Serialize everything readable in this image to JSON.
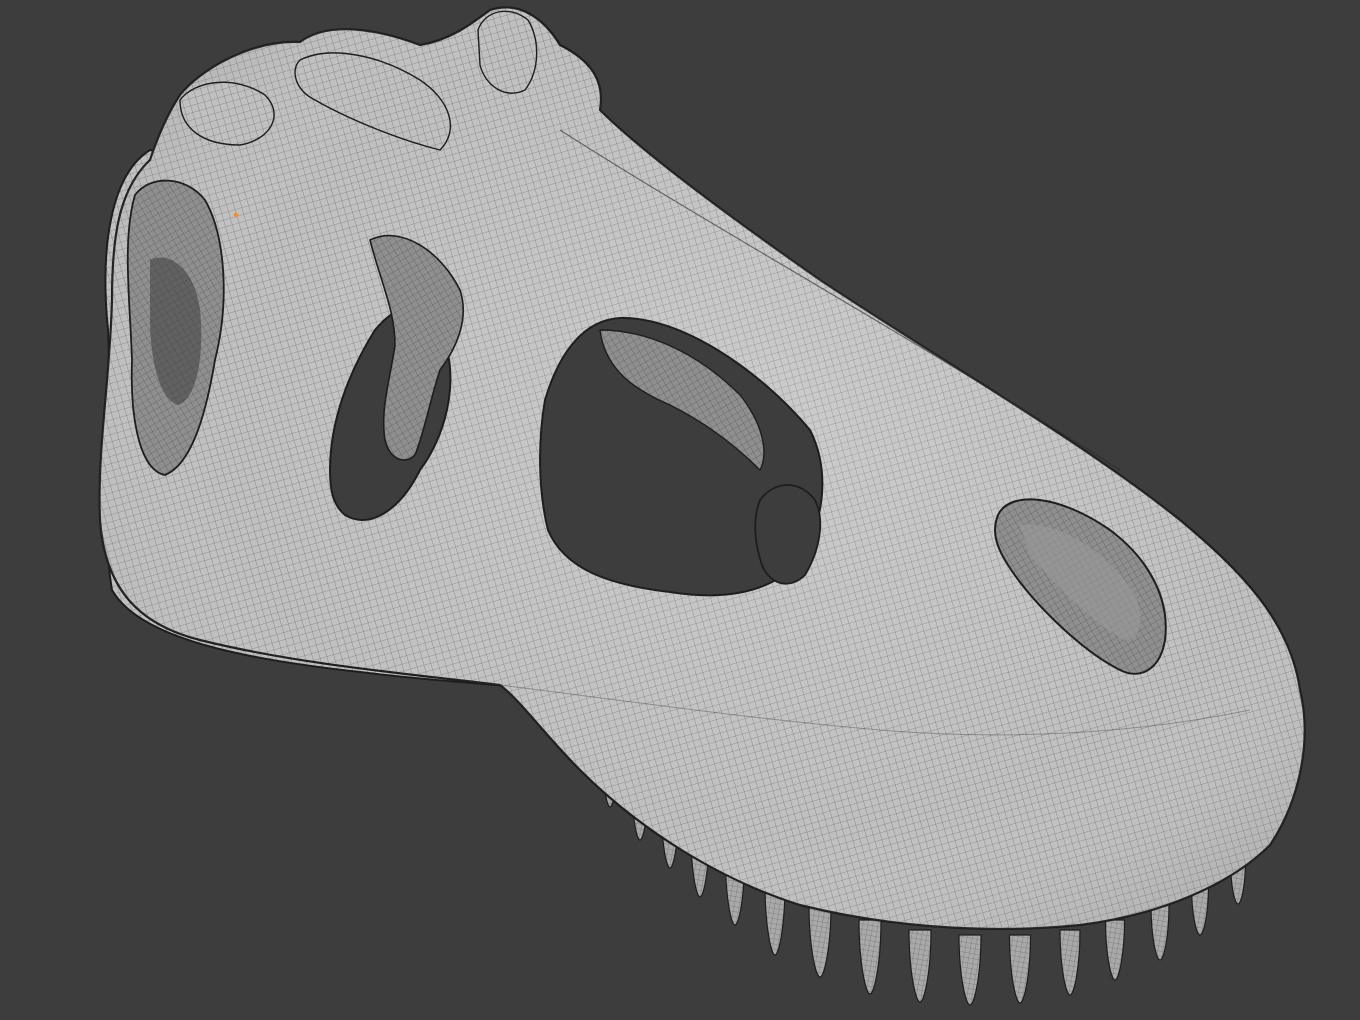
{
  "viewport": {
    "background_color": "#3d3d3d",
    "shading": "solid-wireframe",
    "object": "dinosaur-skull-mesh"
  },
  "mesh": {
    "surface_color": "#bdbdbd",
    "wire_color": "#5a5a5a",
    "outline_color": "#1e1e1e",
    "selected_vertex_color": "#ff8a1f"
  }
}
